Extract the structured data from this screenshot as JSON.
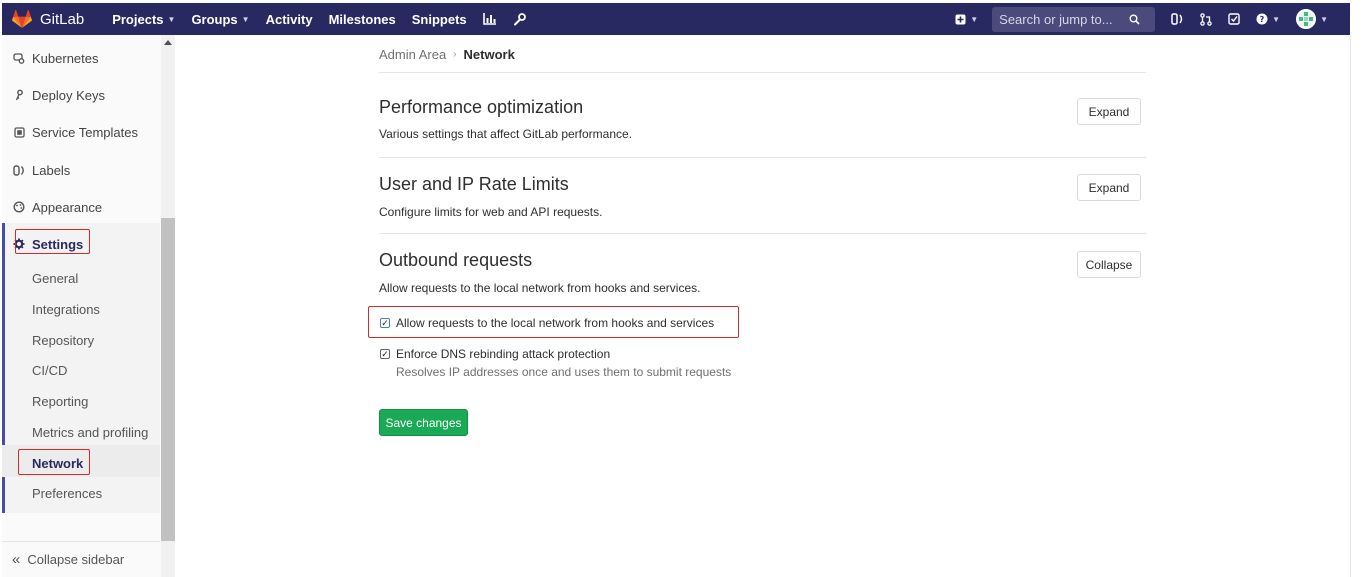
{
  "navbar": {
    "brand": "GitLab",
    "links": [
      {
        "label": "Projects",
        "dropdown": true
      },
      {
        "label": "Groups",
        "dropdown": true
      },
      {
        "label": "Activity",
        "dropdown": false
      },
      {
        "label": "Milestones",
        "dropdown": false
      },
      {
        "label": "Snippets",
        "dropdown": false
      }
    ],
    "search_placeholder": "Search or jump to...",
    "colors": {
      "bg": "#292961",
      "accent": "#fc6d26"
    }
  },
  "sidebar": {
    "items": [
      {
        "label": "Kubernetes",
        "icon": "kubernetes-icon"
      },
      {
        "label": "Deploy Keys",
        "icon": "key-icon"
      },
      {
        "label": "Service Templates",
        "icon": "template-icon"
      },
      {
        "label": "Labels",
        "icon": "labels-icon"
      },
      {
        "label": "Appearance",
        "icon": "appearance-icon"
      }
    ],
    "settings_label": "Settings",
    "settings_subitems": [
      "General",
      "Integrations",
      "Repository",
      "CI/CD",
      "Reporting",
      "Metrics and profiling",
      "Network",
      "Preferences"
    ],
    "active_subitem": "Network",
    "collapse_label": "Collapse sidebar"
  },
  "breadcrumb": {
    "parent": "Admin Area",
    "current": "Network"
  },
  "sections": {
    "performance": {
      "title": "Performance optimization",
      "description": "Various settings that affect GitLab performance.",
      "button": "Expand"
    },
    "rate_limits": {
      "title": "User and IP Rate Limits",
      "description": "Configure limits for web and API requests.",
      "button": "Expand"
    },
    "outbound": {
      "title": "Outbound requests",
      "description": "Allow requests to the local network from hooks and services.",
      "button": "Collapse",
      "allow_local_label": "Allow requests to the local network from hooks and services",
      "allow_local_checked": true,
      "dns_label": "Enforce DNS rebinding attack protection",
      "dns_checked": true,
      "dns_help": "Resolves IP addresses once and uses them to submit requests"
    }
  },
  "save_button": "Save changes"
}
